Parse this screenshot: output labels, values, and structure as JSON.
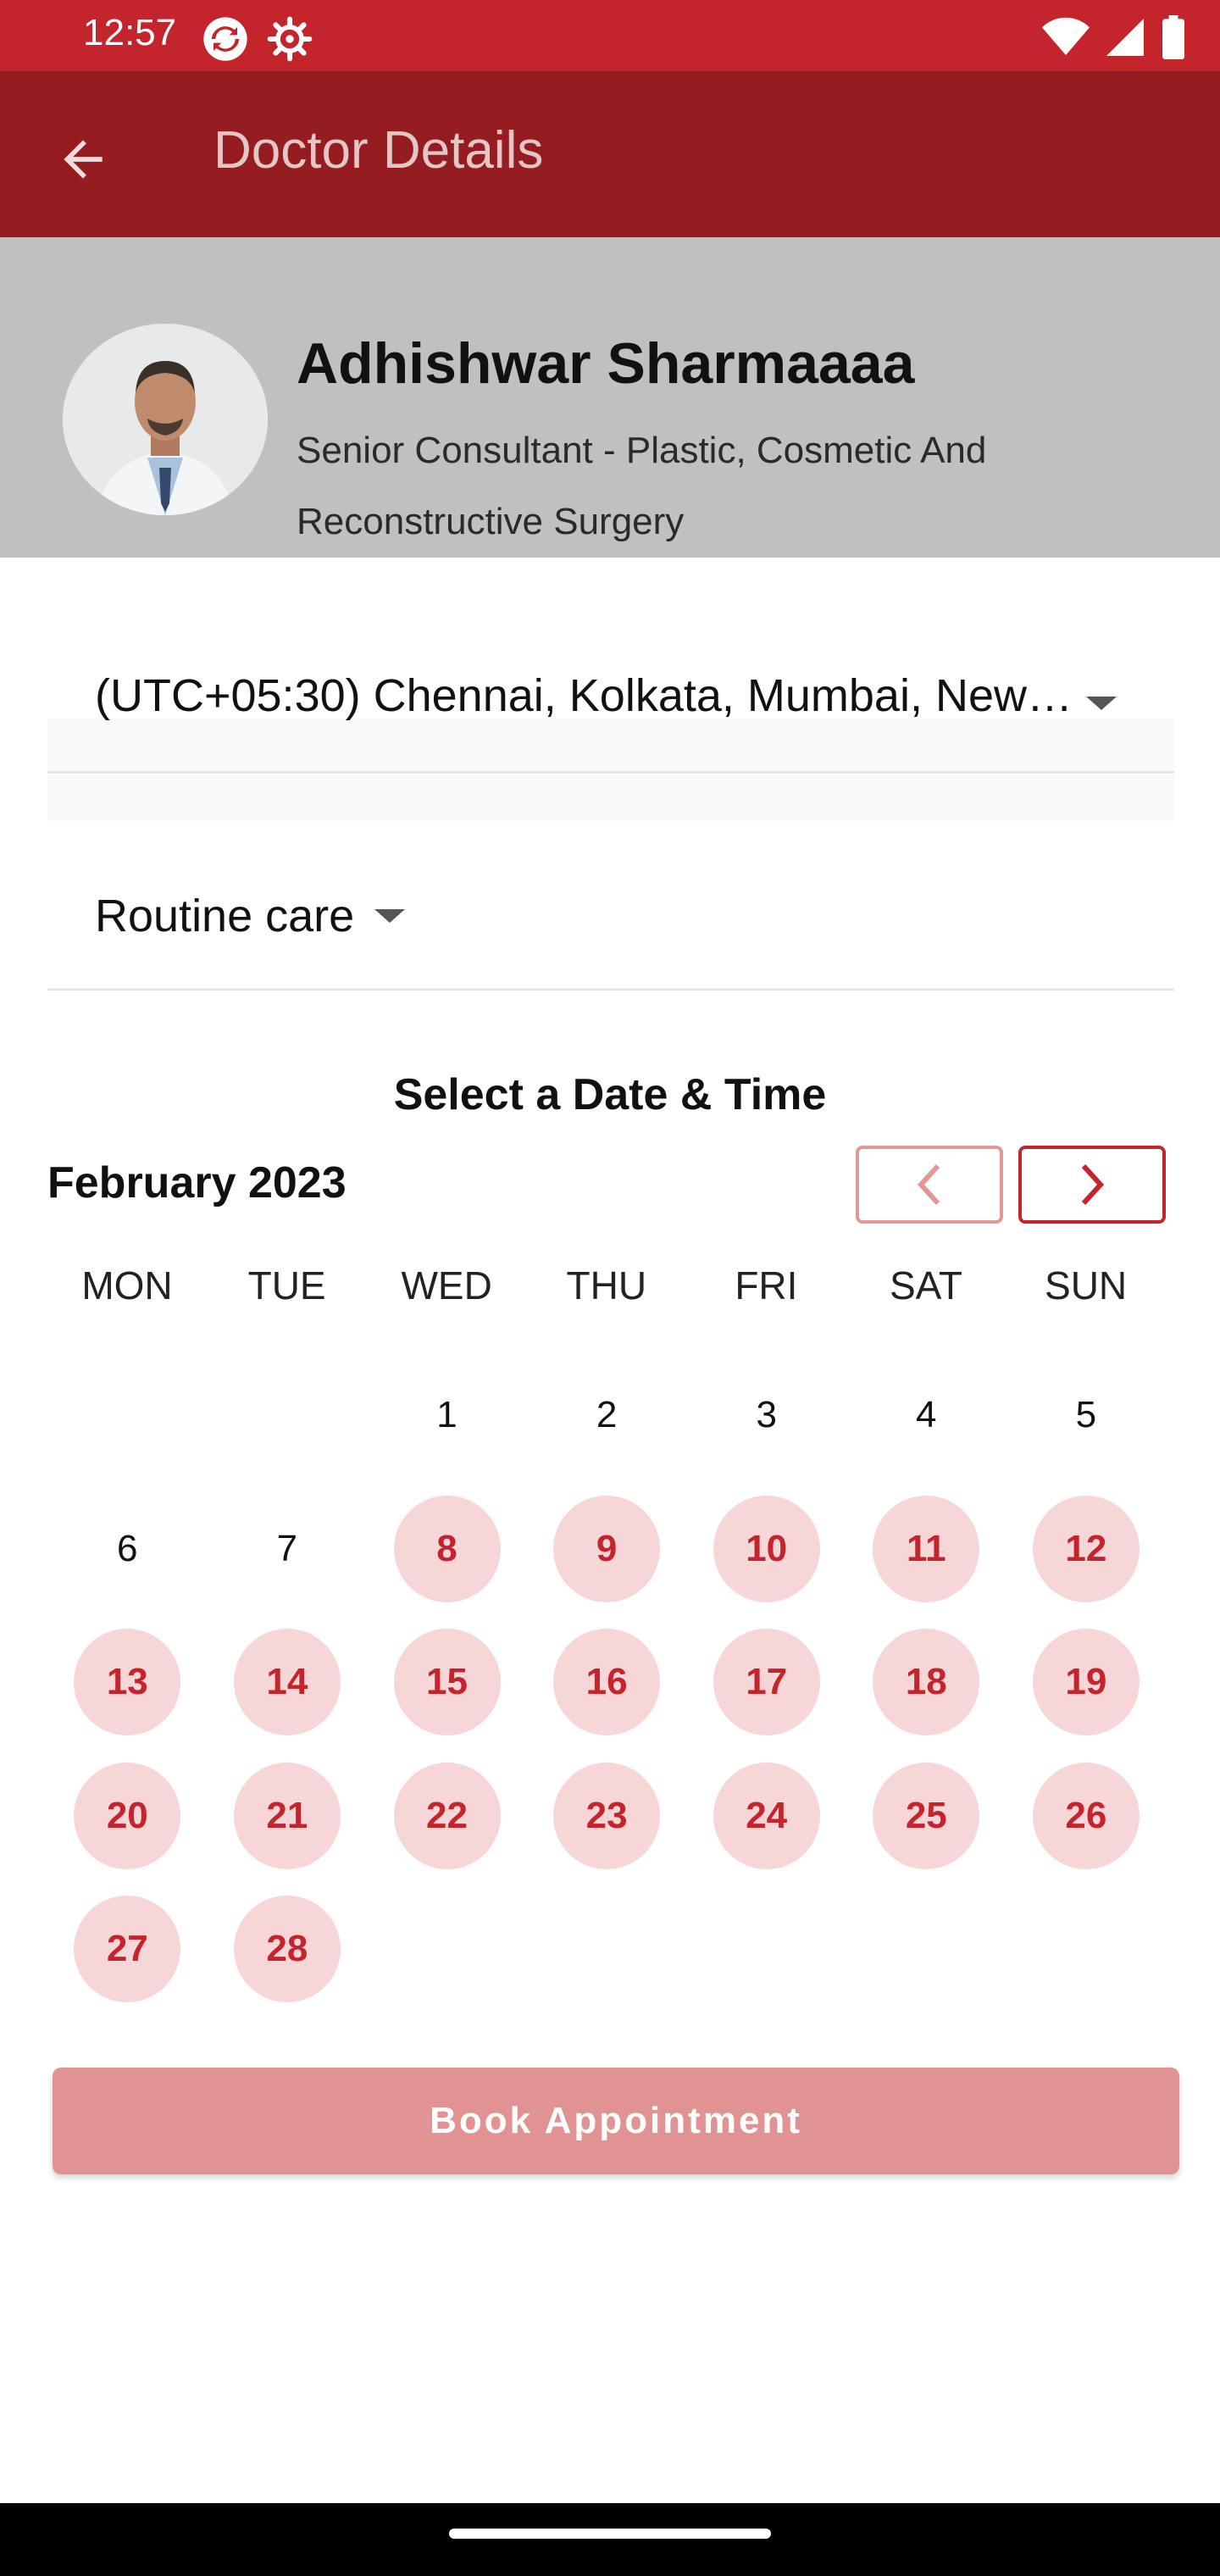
{
  "status_bar": {
    "time": "12:57",
    "icons": [
      "sync-icon",
      "gear-icon",
      "wifi-icon",
      "signal-icon",
      "battery-icon"
    ],
    "color": "#c4252d"
  },
  "app_bar": {
    "title": "Doctor Details",
    "back_icon": "arrow-back-icon",
    "color": "#951c20"
  },
  "doctor": {
    "name": "Adhishwar Sharmaaaa",
    "title": "Senior Consultant - Plastic, Cosmetic And Reconstructive Surgery"
  },
  "timezone": {
    "value": "(UTC+05:30) Chennai, Kolkata, Mumbai, New…"
  },
  "care_type": {
    "value": "Routine care"
  },
  "calendar": {
    "heading": "Select a Date & Time",
    "month": "February 2023",
    "weekdays": [
      "MON",
      "TUE",
      "WED",
      "THU",
      "FRI",
      "SAT",
      "SUN"
    ],
    "first_weekday_index": 2,
    "days": [
      {
        "n": "1",
        "available": false
      },
      {
        "n": "2",
        "available": false
      },
      {
        "n": "3",
        "available": false
      },
      {
        "n": "4",
        "available": false
      },
      {
        "n": "5",
        "available": false
      },
      {
        "n": "6",
        "available": false
      },
      {
        "n": "7",
        "available": false
      },
      {
        "n": "8",
        "available": true
      },
      {
        "n": "9",
        "available": true
      },
      {
        "n": "10",
        "available": true
      },
      {
        "n": "11",
        "available": true
      },
      {
        "n": "12",
        "available": true
      },
      {
        "n": "13",
        "available": true
      },
      {
        "n": "14",
        "available": true
      },
      {
        "n": "15",
        "available": true
      },
      {
        "n": "16",
        "available": true
      },
      {
        "n": "17",
        "available": true
      },
      {
        "n": "18",
        "available": true
      },
      {
        "n": "19",
        "available": true
      },
      {
        "n": "20",
        "available": true
      },
      {
        "n": "21",
        "available": true
      },
      {
        "n": "22",
        "available": true
      },
      {
        "n": "23",
        "available": true
      },
      {
        "n": "24",
        "available": true
      },
      {
        "n": "25",
        "available": true
      },
      {
        "n": "26",
        "available": true
      },
      {
        "n": "27",
        "available": true
      },
      {
        "n": "28",
        "available": true
      }
    ],
    "accent_color": "#c4252d",
    "available_bg": "#f7d6d8"
  },
  "actions": {
    "book_label": "Book Appointment"
  }
}
